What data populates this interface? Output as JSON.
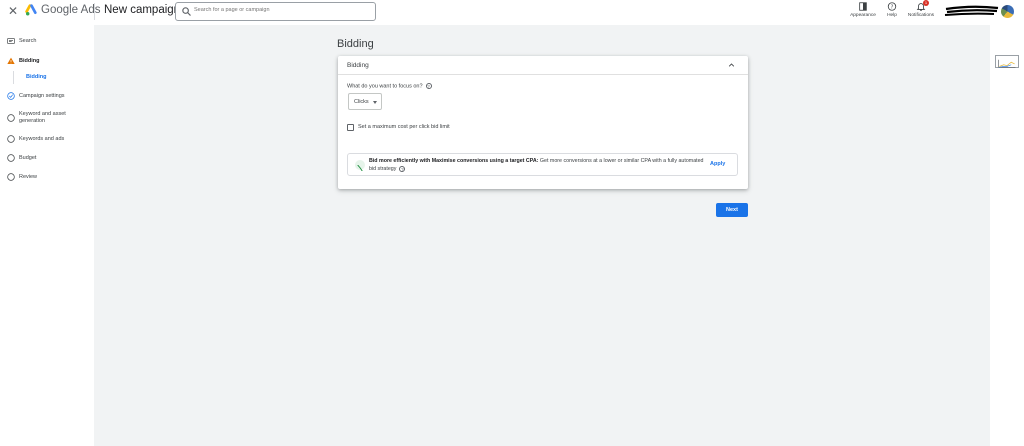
{
  "header": {
    "close_icon": "close-icon",
    "brand": "Google Ads",
    "page_title": "New campaign",
    "search_placeholder": "Search for a page or campaign",
    "actions": [
      {
        "label": "Appearance",
        "icon": "appearance-icon"
      },
      {
        "label": "Help",
        "icon": "help-icon"
      },
      {
        "label": "Notifications",
        "icon": "bell-icon",
        "badge": "1"
      }
    ]
  },
  "sidebar": {
    "items": [
      {
        "label": "Search",
        "icon": "search-campaign-icon"
      },
      {
        "label": "Bidding",
        "icon": "warning-icon"
      },
      {
        "label": "Campaign settings",
        "icon": "check-circle-icon"
      },
      {
        "label": "Keyword and asset generation",
        "icon": "circle-icon"
      },
      {
        "label": "Keywords and ads",
        "icon": "circle-icon"
      },
      {
        "label": "Budget",
        "icon": "circle-icon"
      },
      {
        "label": "Review",
        "icon": "circle-icon"
      }
    ],
    "subitem": "Bidding"
  },
  "main": {
    "section_title": "Bidding",
    "card": {
      "title": "Bidding",
      "focus_question": "What do you want to focus on?",
      "focus_value": "Clicks",
      "max_cpc_label": "Set a maximum cost per click bid limit",
      "recommendation": {
        "bold": "Bid more efficiently with Maximise conversions using a target CPA:",
        "text": " Get more conversions at a lower or similar CPA with a fully automated bid strategy",
        "apply": "Apply"
      }
    },
    "next": "Next"
  },
  "colors": {
    "primary": "#1a73e8",
    "warning": "#e37400",
    "success": "#1e8e3e",
    "badge": "#d93025"
  }
}
